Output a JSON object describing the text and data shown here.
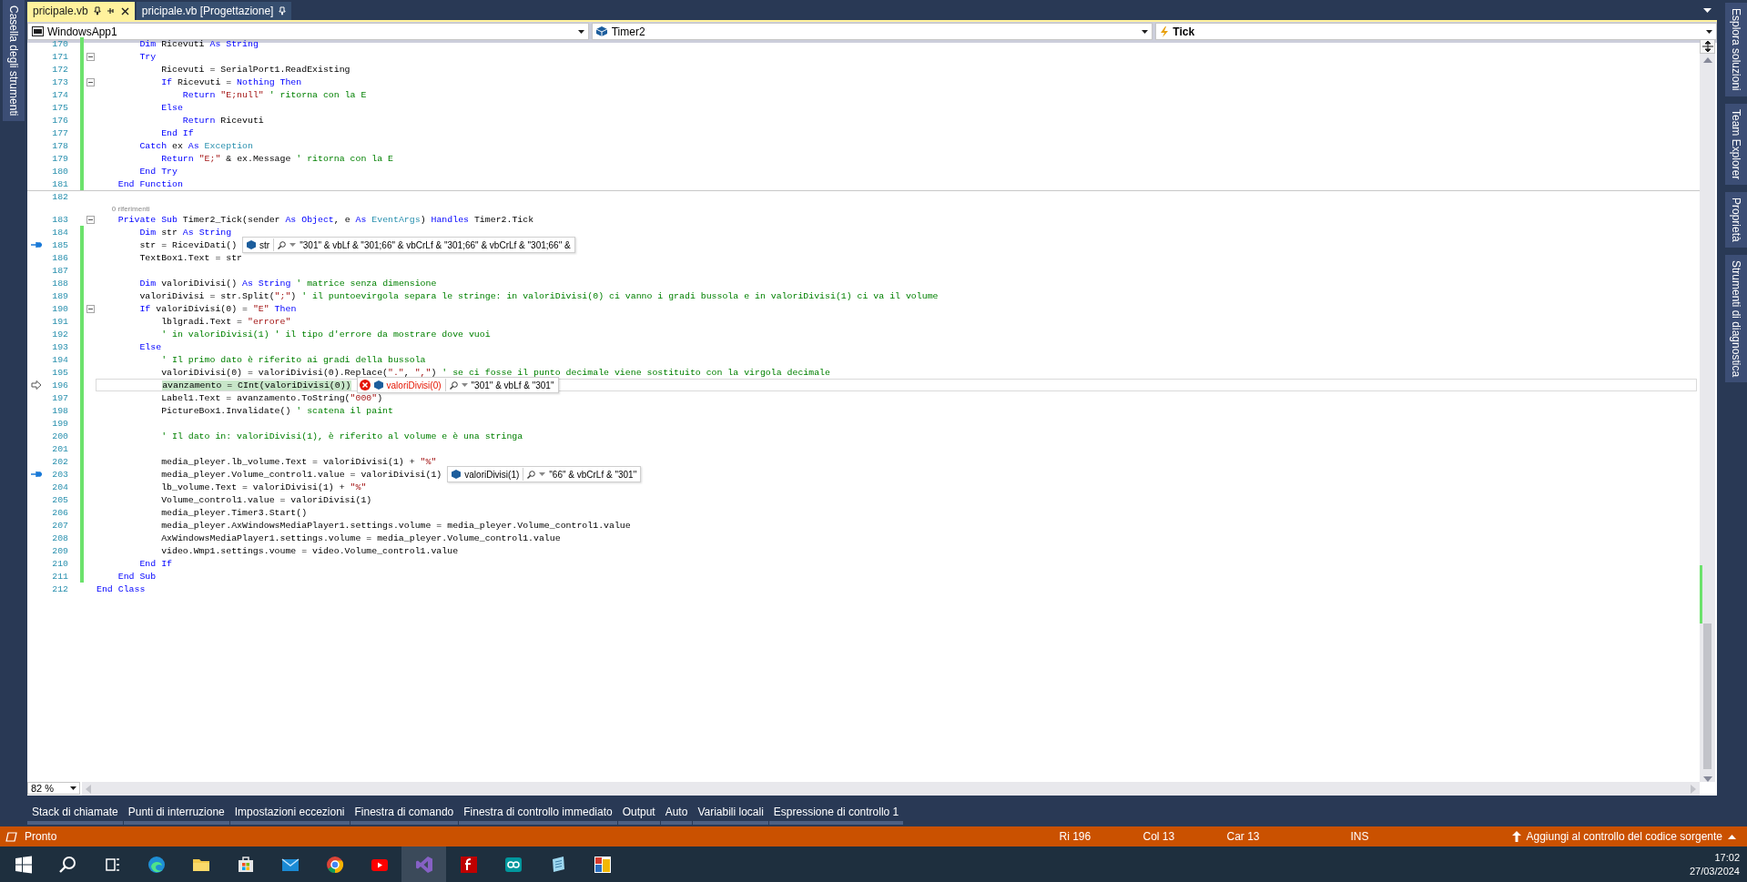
{
  "document_tabs": [
    {
      "label": "pricipale.vb",
      "selected": true,
      "closable": true
    },
    {
      "label": "pricipale.vb [Progettazione]",
      "selected": false,
      "closable": false
    }
  ],
  "left_panel_tabs": [
    "Casella degli strumenti"
  ],
  "right_panel_tabs": [
    "Esplora soluzioni",
    "Team Explorer",
    "Proprietà",
    "Strumenti di diagnostica"
  ],
  "navigation_bar": [
    {
      "kind": "project",
      "text": "WindowsApp1"
    },
    {
      "kind": "object",
      "text": "Timer2"
    },
    {
      "kind": "member",
      "text": "Tick"
    }
  ],
  "editor": {
    "zoom": "82 %",
    "lines": [
      {
        "number": "170",
        "kind": "plain",
        "modified": true,
        "fold": false,
        "tokens": [
          {
            "kind": "kw",
            "text": "        Dim"
          },
          {
            "kind": "text",
            "text": " Ricevuti "
          },
          {
            "kind": "kw",
            "text": "As String"
          }
        ]
      },
      {
        "number": "171",
        "kind": "plain",
        "modified": true,
        "fold": true,
        "tokens": [
          {
            "kind": "kw",
            "text": "        Try"
          }
        ]
      },
      {
        "number": "172",
        "kind": "plain",
        "modified": true,
        "fold": false,
        "tokens": [
          {
            "kind": "text",
            "text": "            Ricevuti = SerialPort1.ReadExisting"
          }
        ]
      },
      {
        "number": "173",
        "kind": "plain",
        "modified": true,
        "fold": true,
        "tokens": [
          {
            "kind": "kw",
            "text": "            If"
          },
          {
            "kind": "text",
            "text": " Ricevuti = "
          },
          {
            "kind": "kw",
            "text": "Nothing Then"
          }
        ]
      },
      {
        "number": "174",
        "kind": "plain",
        "modified": true,
        "fold": false,
        "tokens": [
          {
            "kind": "kw",
            "text": "                Return"
          },
          {
            "kind": "str",
            "text": " \"E;null\""
          },
          {
            "kind": "cmt",
            "text": " ' ritorna con la E"
          }
        ]
      },
      {
        "number": "175",
        "kind": "plain",
        "modified": true,
        "fold": false,
        "tokens": [
          {
            "kind": "kw",
            "text": "            Else"
          }
        ]
      },
      {
        "number": "176",
        "kind": "plain",
        "modified": true,
        "fold": false,
        "tokens": [
          {
            "kind": "kw",
            "text": "                Return"
          },
          {
            "kind": "text",
            "text": " Ricevuti"
          }
        ]
      },
      {
        "number": "177",
        "kind": "plain",
        "modified": true,
        "fold": false,
        "tokens": [
          {
            "kind": "kw",
            "text": "            End If"
          }
        ]
      },
      {
        "number": "178",
        "kind": "plain",
        "modified": true,
        "fold": false,
        "tokens": [
          {
            "kind": "kw",
            "text": "        Catch"
          },
          {
            "kind": "text",
            "text": " ex "
          },
          {
            "kind": "kw",
            "text": "As"
          },
          {
            "kind": "type",
            "text": " Exception"
          }
        ]
      },
      {
        "number": "179",
        "kind": "plain",
        "modified": true,
        "fold": false,
        "tokens": [
          {
            "kind": "kw",
            "text": "            Return"
          },
          {
            "kind": "str",
            "text": " \"E;\""
          },
          {
            "kind": "text",
            "text": " & ex.Message "
          },
          {
            "kind": "cmt",
            "text": "' ritorna con la E"
          }
        ]
      },
      {
        "number": "180",
        "kind": "plain",
        "modified": true,
        "fold": false,
        "tokens": [
          {
            "kind": "kw",
            "text": "        End Try"
          }
        ]
      },
      {
        "number": "181",
        "kind": "plain",
        "modified": true,
        "fold": false,
        "tokens": [
          {
            "kind": "kw",
            "text": "    End Function"
          }
        ]
      },
      {
        "number": "182",
        "kind": "plain",
        "modified": false,
        "fold": false,
        "separator_above": true
      },
      {
        "number": "183",
        "kind": "plain",
        "modified": false,
        "fold": true,
        "codelens": "0 riferimenti",
        "tokens": [
          {
            "kind": "kw",
            "text": "    Private Sub"
          },
          {
            "kind": "text",
            "text": " Timer2_Tick(sender "
          },
          {
            "kind": "kw",
            "text": "As Object"
          },
          {
            "kind": "text",
            "text": ", e "
          },
          {
            "kind": "kw",
            "text": "As"
          },
          {
            "kind": "type",
            "text": " EventArgs"
          },
          {
            "kind": "text",
            "text": ") "
          },
          {
            "kind": "kw",
            "text": "Handles"
          },
          {
            "kind": "text",
            "text": " Timer2.Tick"
          }
        ]
      },
      {
        "number": "184",
        "kind": "plain",
        "modified": true,
        "fold": false,
        "tokens": [
          {
            "kind": "kw",
            "text": "        Dim"
          },
          {
            "kind": "text",
            "text": " str "
          },
          {
            "kind": "kw",
            "text": "As String"
          }
        ]
      },
      {
        "number": "185",
        "kind": "pinned",
        "modified": true,
        "fold": false,
        "tokens": [
          {
            "kind": "text",
            "text": "        str = RiceviDati()"
          }
        ],
        "datatip": {
          "kind": "value",
          "name": "str",
          "value": "\"301\" & vbLf & \"301;66\" & vbCrLf & \"301;66\" & vbCrLf & \"301;66\" &"
        }
      },
      {
        "number": "186",
        "kind": "plain",
        "modified": true,
        "fold": false,
        "tokens": [
          {
            "kind": "text",
            "text": "        TextBox1.Text = str"
          }
        ]
      },
      {
        "number": "187",
        "kind": "plain",
        "modified": true,
        "fold": false
      },
      {
        "number": "188",
        "kind": "plain",
        "modified": true,
        "fold": false,
        "tokens": [
          {
            "kind": "kw",
            "text": "        Dim"
          },
          {
            "kind": "text",
            "text": " valoriDivisi() "
          },
          {
            "kind": "kw",
            "text": "As String"
          },
          {
            "kind": "cmt",
            "text": " ' matrice senza dimensione"
          }
        ]
      },
      {
        "number": "189",
        "kind": "plain",
        "modified": true,
        "fold": false,
        "tokens": [
          {
            "kind": "text",
            "text": "        valoriDivisi = str.Split("
          },
          {
            "kind": "str",
            "text": "\";\""
          },
          {
            "kind": "text",
            "text": ") "
          },
          {
            "kind": "cmt",
            "text": "' il puntoevirgola separa le stringe: in valoriDivisi(0) ci vanno i gradi bussola e in valoriDivisi(1) ci va il volume"
          }
        ]
      },
      {
        "number": "190",
        "kind": "plain",
        "modified": true,
        "fold": true,
        "tokens": [
          {
            "kind": "kw",
            "text": "        If"
          },
          {
            "kind": "text",
            "text": " valoriDivisi(0) = "
          },
          {
            "kind": "str",
            "text": "\"E\""
          },
          {
            "kind": "kw",
            "text": " Then"
          }
        ]
      },
      {
        "number": "191",
        "kind": "plain",
        "modified": true,
        "fold": false,
        "tokens": [
          {
            "kind": "text",
            "text": "            lblgradi.Text = "
          },
          {
            "kind": "str",
            "text": "\"errore\""
          }
        ]
      },
      {
        "number": "192",
        "kind": "plain",
        "modified": true,
        "fold": false,
        "tokens": [
          {
            "kind": "cmt",
            "text": "            ' in valoriDivisi(1) ' il tipo d'errore da mostrare dove vuoi"
          }
        ]
      },
      {
        "number": "193",
        "kind": "plain",
        "modified": true,
        "fold": false,
        "tokens": [
          {
            "kind": "kw",
            "text": "        Else"
          }
        ]
      },
      {
        "number": "194",
        "kind": "plain",
        "modified": true,
        "fold": false,
        "tokens": [
          {
            "kind": "cmt",
            "text": "            ' Il primo dato è riferito ai gradi della bussola"
          }
        ]
      },
      {
        "number": "195",
        "kind": "plain",
        "modified": true,
        "fold": false,
        "tokens": [
          {
            "kind": "text",
            "text": "            valoriDivisi(0) = valoriDivisi(0).Replace("
          },
          {
            "kind": "str",
            "text": "\".\""
          },
          {
            "kind": "text",
            "text": ", "
          },
          {
            "kind": "str",
            "text": "\",\""
          },
          {
            "kind": "text",
            "text": ") "
          },
          {
            "kind": "cmt",
            "text": "' se ci fosse il punto decimale viene sostituito con la virgola decimale"
          }
        ]
      },
      {
        "number": "196",
        "kind": "current",
        "modified": true,
        "fold": false,
        "tokens": [
          {
            "kind": "hl",
            "text": "            avanzamento = CInt(valoriDivisi(0))"
          }
        ],
        "datatip": {
          "kind": "error",
          "name": "valoriDivisi(0)",
          "value": "\"301\" & vbLf & \"301\""
        }
      },
      {
        "number": "197",
        "kind": "plain",
        "modified": true,
        "fold": false,
        "tokens": [
          {
            "kind": "text",
            "text": "            Label1.Text = avanzamento.ToString("
          },
          {
            "kind": "str",
            "text": "\"000\""
          },
          {
            "kind": "text",
            "text": ")"
          }
        ]
      },
      {
        "number": "198",
        "kind": "plain",
        "modified": true,
        "fold": false,
        "tokens": [
          {
            "kind": "text",
            "text": "            PictureBox1.Invalidate() "
          },
          {
            "kind": "cmt",
            "text": "' scatena il paint"
          }
        ]
      },
      {
        "number": "199",
        "kind": "plain",
        "modified": true,
        "fold": false
      },
      {
        "number": "200",
        "kind": "plain",
        "modified": true,
        "fold": false,
        "tokens": [
          {
            "kind": "cmt",
            "text": "            ' Il dato in: valoriDivisi(1), è riferito al volume e è una stringa"
          }
        ]
      },
      {
        "number": "201",
        "kind": "plain",
        "modified": true,
        "fold": false
      },
      {
        "number": "202",
        "kind": "plain",
        "modified": true,
        "fold": false,
        "tokens": [
          {
            "kind": "text",
            "text": "            media_pleyer.lb_volume.Text = valoriDivisi(1) + "
          },
          {
            "kind": "str",
            "text": "\"%\""
          }
        ]
      },
      {
        "number": "203",
        "kind": "pinned",
        "modified": true,
        "fold": false,
        "tokens": [
          {
            "kind": "text",
            "text": "            media_pleyer.Volume_control1.value = valoriDivisi(1)"
          }
        ],
        "datatip": {
          "kind": "value",
          "name": "valoriDivisi(1)",
          "value": "\"66\" & vbCrLf & \"301\""
        }
      },
      {
        "number": "204",
        "kind": "plain",
        "modified": true,
        "fold": false,
        "tokens": [
          {
            "kind": "text",
            "text": "            lb_volume.Text = valoriDivisi(1) + "
          },
          {
            "kind": "str",
            "text": "\"%\""
          }
        ]
      },
      {
        "number": "205",
        "kind": "plain",
        "modified": true,
        "fold": false,
        "tokens": [
          {
            "kind": "text",
            "text": "            Volume_control1.value = valoriDivisi(1)"
          }
        ]
      },
      {
        "number": "206",
        "kind": "plain",
        "modified": true,
        "fold": false,
        "tokens": [
          {
            "kind": "text",
            "text": "            media_pleyer.Timer3.Start()"
          }
        ]
      },
      {
        "number": "207",
        "kind": "plain",
        "modified": true,
        "fold": false,
        "tokens": [
          {
            "kind": "text",
            "text": "            media_pleyer.AxWindowsMediaPlayer1.settings.volume = media_pleyer.Volume_control1.value"
          }
        ]
      },
      {
        "number": "208",
        "kind": "plain",
        "modified": true,
        "fold": false,
        "tokens": [
          {
            "kind": "text",
            "text": "            AxWindowsMediaPlayer1.settings.volume = media_pleyer.Volume_control1.value"
          }
        ]
      },
      {
        "number": "209",
        "kind": "plain",
        "modified": true,
        "fold": false,
        "tokens": [
          {
            "kind": "text",
            "text": "            video.Wmp1.settings.voume = video.Volume_control1.value"
          }
        ]
      },
      {
        "number": "210",
        "kind": "plain",
        "modified": true,
        "fold": false,
        "tokens": [
          {
            "kind": "kw",
            "text": "        End If"
          }
        ]
      },
      {
        "number": "211",
        "kind": "plain",
        "modified": true,
        "fold": false,
        "tokens": [
          {
            "kind": "kw",
            "text": "    End Sub"
          }
        ]
      },
      {
        "number": "212",
        "kind": "plain",
        "modified": false,
        "fold": false,
        "tokens": [
          {
            "kind": "kw",
            "text": "End Class"
          }
        ]
      }
    ]
  },
  "tool_tabs": [
    "Stack di chiamate",
    "Punti di interruzione",
    "Impostazioni eccezioni",
    "Finestra di comando",
    "Finestra di controllo immediato",
    "Output",
    "Auto",
    "Variabili locali",
    "Espressione di controllo 1"
  ],
  "status_bar": {
    "message": "Pronto",
    "line": "Ri 196",
    "column": "Col 13",
    "character": "Car 13",
    "mode": "INS",
    "source_control": "Aggiungi al controllo del codice sorgente"
  },
  "taskbar": {
    "apps": [
      {
        "kind": "start",
        "selected": false
      },
      {
        "kind": "search",
        "selected": false
      },
      {
        "kind": "taskview",
        "selected": false
      },
      {
        "kind": "edge",
        "selected": false
      },
      {
        "kind": "folder",
        "selected": false
      },
      {
        "kind": "store",
        "selected": false
      },
      {
        "kind": "mail",
        "selected": false
      },
      {
        "kind": "chrome",
        "selected": false
      },
      {
        "kind": "video",
        "selected": false
      },
      {
        "kind": "vs",
        "selected": true
      },
      {
        "kind": "ftp",
        "selected": false
      },
      {
        "kind": "arduino",
        "selected": false
      },
      {
        "kind": "notepad",
        "selected": false
      },
      {
        "kind": "paint",
        "selected": false
      }
    ],
    "time": "17:02",
    "date": "27/03/2024"
  }
}
